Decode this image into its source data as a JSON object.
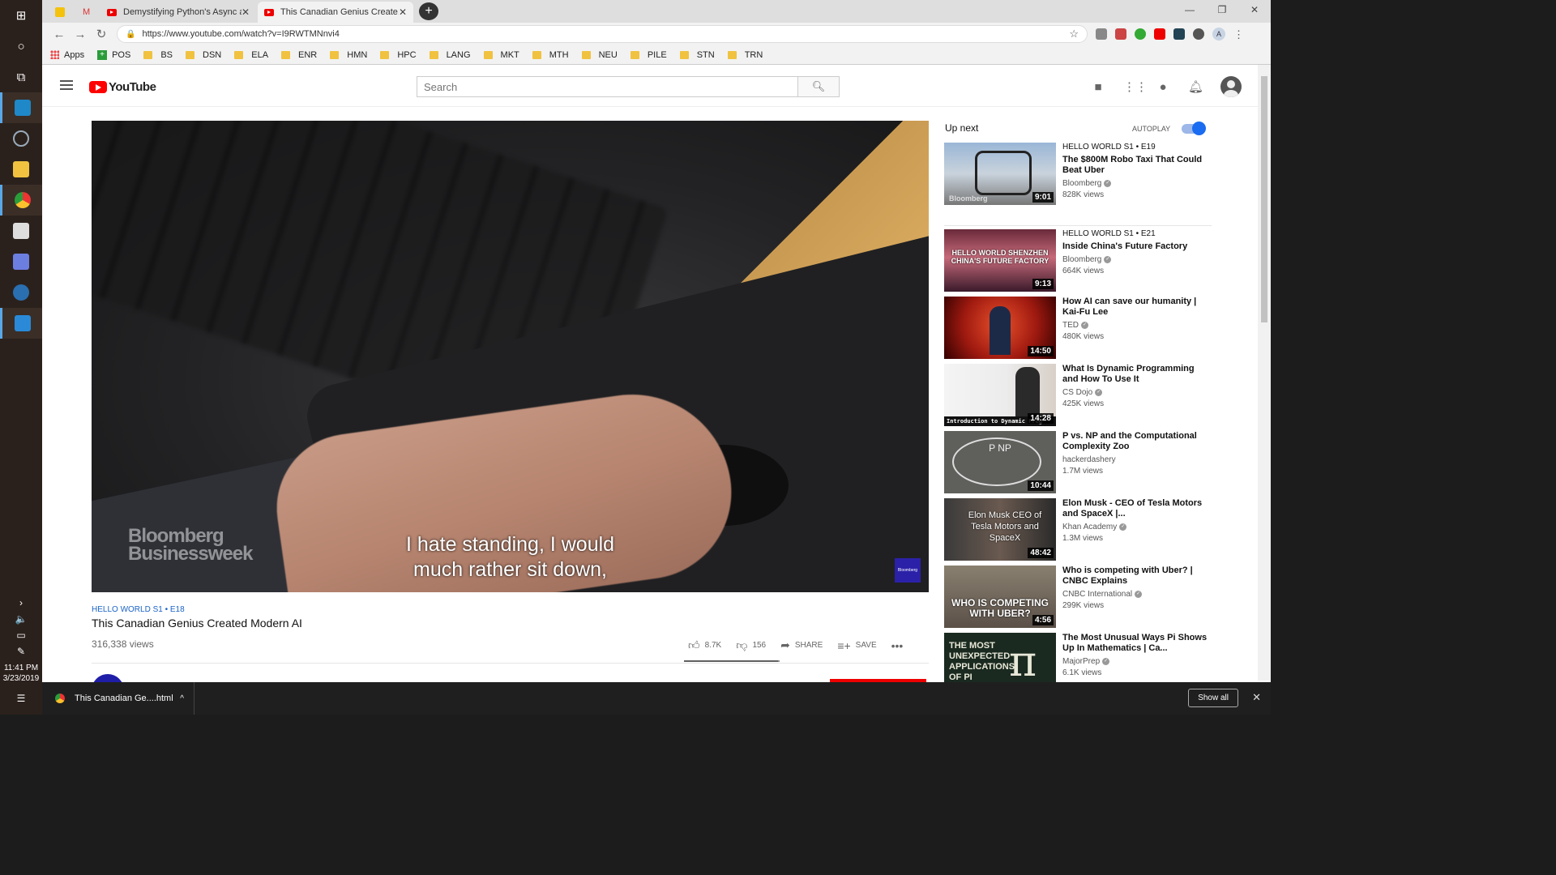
{
  "taskbar": {
    "clock_time": "11:41 PM",
    "clock_date": "3/23/2019"
  },
  "tabs": [
    {
      "label": "Demystifying Python's Async and..."
    },
    {
      "label": "This Canadian Genius Create..."
    }
  ],
  "address_bar": {
    "url": "https://www.youtube.com/watch?v=I9RWTMNnvi4"
  },
  "profile_initial": "A",
  "bookmarks": [
    "Apps",
    "POS",
    "BS",
    "DSN",
    "ELA",
    "ENR",
    "HMN",
    "HPC",
    "LANG",
    "MKT",
    "MTH",
    "NEU",
    "PILE",
    "STN",
    "TRN"
  ],
  "youtube": {
    "logo_text": "YouTube",
    "search_placeholder": "Search"
  },
  "player": {
    "watermark_line1": "Bloomberg",
    "watermark_line2": "Businessweek",
    "subtitle_line1": "I hate standing, I would",
    "subtitle_line2": "much rather sit down,",
    "corner_badge": "Bloomberg"
  },
  "video": {
    "tags": "HELLO WORLD  S1 • E18",
    "title": "This Canadian Genius Created Modern AI",
    "views": "316,338 views",
    "likes": "8.7K",
    "dislikes": "156",
    "share_label": "SHARE",
    "save_label": "SAVE",
    "like_ratio": 0.982
  },
  "sidebar": {
    "up_next_label": "Up next",
    "autoplay_label": "AUTOPLAY",
    "autoplay_on": true,
    "recs": [
      {
        "episode": "HELLO WORLD  S1 • E19",
        "title": "The $800M Robo Taxi That Could Beat Uber",
        "channel": "Bloomberg",
        "views": "828K views",
        "duration": "9:01",
        "thumb_label": "Bloomberg"
      },
      {
        "episode": "HELLO WORLD  S1 • E21",
        "title": "Inside China's Future Factory",
        "channel": "Bloomberg",
        "views": "664K views",
        "duration": "9:13",
        "thumb_label": "HELLO WORLD SHENZHEN CHINA'S FUTURE FACTORY"
      },
      {
        "episode": "",
        "title": "How AI can save our humanity | Kai-Fu Lee",
        "channel": "TED",
        "views": "480K views",
        "duration": "14:50",
        "thumb_label": ""
      },
      {
        "episode": "",
        "title": "What Is Dynamic Programming and How To Use It",
        "channel": "CS Dojo",
        "views": "425K views",
        "duration": "14:28",
        "thumb_label": "Introduction to Dynamic Prog"
      },
      {
        "episode": "",
        "title": "P vs. NP and the Computational Complexity Zoo",
        "channel": "hackerdashery",
        "views": "1.7M views",
        "duration": "10:44",
        "thumb_label": "P  NP"
      },
      {
        "episode": "",
        "title": "Elon Musk - CEO of Tesla Motors and SpaceX |...",
        "channel": "Khan Academy",
        "views": "1.3M views",
        "duration": "48:42",
        "thumb_label": "Elon Musk CEO of Tesla Motors and SpaceX"
      },
      {
        "episode": "",
        "title": "Who is competing with Uber? | CNBC Explains",
        "channel": "CNBC International",
        "views": "299K views",
        "duration": "4:56",
        "thumb_label": "WHO IS COMPETING WITH UBER?"
      },
      {
        "episode": "",
        "title": "The Most Unusual Ways Pi Shows Up In Mathematics | Ca...",
        "channel": "MajorPrep",
        "views": "6.1K views",
        "duration": "",
        "thumb_label": "THE MOST UNEXPECTED APPLICATIONS OF PI"
      }
    ]
  },
  "download_bar": {
    "file_name": "This Canadian Ge....html",
    "show_all_label": "Show all"
  },
  "colors": {
    "yt_red": "#ff0000",
    "link_blue": "#1a63c7",
    "toggle_blue": "#1a6cf0",
    "taskbar_bg": "#2b211c"
  }
}
